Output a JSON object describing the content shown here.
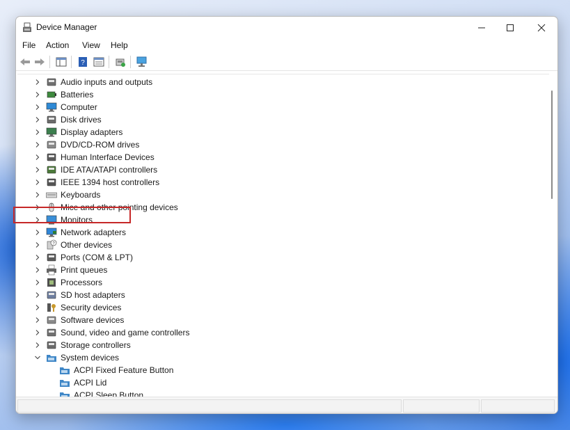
{
  "window": {
    "title": "Device Manager",
    "controls": {
      "minimize": "minimize",
      "maximize": "maximize",
      "close": "close"
    }
  },
  "menu": [
    "File",
    "Action",
    "View",
    "Help"
  ],
  "toolbar": {
    "icons": [
      "back-arrow-icon",
      "forward-arrow-icon",
      "properties-icon",
      "help-icon",
      "show-hide-console-tree-icon",
      "update-driver-icon",
      "scan-hardware-icon"
    ]
  },
  "tree": {
    "categories": [
      {
        "label": "Audio inputs and outputs",
        "icon": "speaker-icon",
        "expanded": false
      },
      {
        "label": "Batteries",
        "icon": "battery-icon",
        "expanded": false
      },
      {
        "label": "Computer",
        "icon": "computer-icon",
        "expanded": false
      },
      {
        "label": "Disk drives",
        "icon": "disk-drive-icon",
        "expanded": false
      },
      {
        "label": "Display adapters",
        "icon": "display-adapter-icon",
        "expanded": false
      },
      {
        "label": "DVD/CD-ROM drives",
        "icon": "dvd-drive-icon",
        "expanded": false
      },
      {
        "label": "Human Interface Devices",
        "icon": "hid-icon",
        "expanded": false
      },
      {
        "label": "IDE ATA/ATAPI controllers",
        "icon": "ide-controller-icon",
        "expanded": false
      },
      {
        "label": "IEEE 1394 host controllers",
        "icon": "ieee1394-icon",
        "expanded": false
      },
      {
        "label": "Keyboards",
        "icon": "keyboard-icon",
        "expanded": false
      },
      {
        "label": "Mice and other pointing devices",
        "icon": "mouse-icon",
        "expanded": false
      },
      {
        "label": "Monitors",
        "icon": "monitor-icon",
        "expanded": false
      },
      {
        "label": "Network adapters",
        "icon": "network-adapter-icon",
        "expanded": false,
        "highlighted": true
      },
      {
        "label": "Other devices",
        "icon": "other-devices-icon",
        "expanded": false
      },
      {
        "label": "Ports (COM & LPT)",
        "icon": "port-icon",
        "expanded": false
      },
      {
        "label": "Print queues",
        "icon": "printer-icon",
        "expanded": false
      },
      {
        "label": "Processors",
        "icon": "processor-icon",
        "expanded": false
      },
      {
        "label": "SD host adapters",
        "icon": "sd-card-icon",
        "expanded": false
      },
      {
        "label": "Security devices",
        "icon": "security-icon",
        "expanded": false
      },
      {
        "label": "Software devices",
        "icon": "software-device-icon",
        "expanded": false
      },
      {
        "label": "Sound, video and game controllers",
        "icon": "sound-icon",
        "expanded": false
      },
      {
        "label": "Storage controllers",
        "icon": "storage-controller-icon",
        "expanded": false
      },
      {
        "label": "System devices",
        "icon": "system-devices-icon",
        "expanded": true
      }
    ],
    "system_devices_children": [
      {
        "label": "ACPI Fixed Feature Button",
        "icon": "system-device-icon"
      },
      {
        "label": "ACPI Lid",
        "icon": "system-device-icon"
      },
      {
        "label": "ACPI Sleep Button",
        "icon": "system-device-icon"
      }
    ]
  },
  "colors": {
    "highlight_box": "#c62828",
    "accent": "#1f6fd1"
  }
}
